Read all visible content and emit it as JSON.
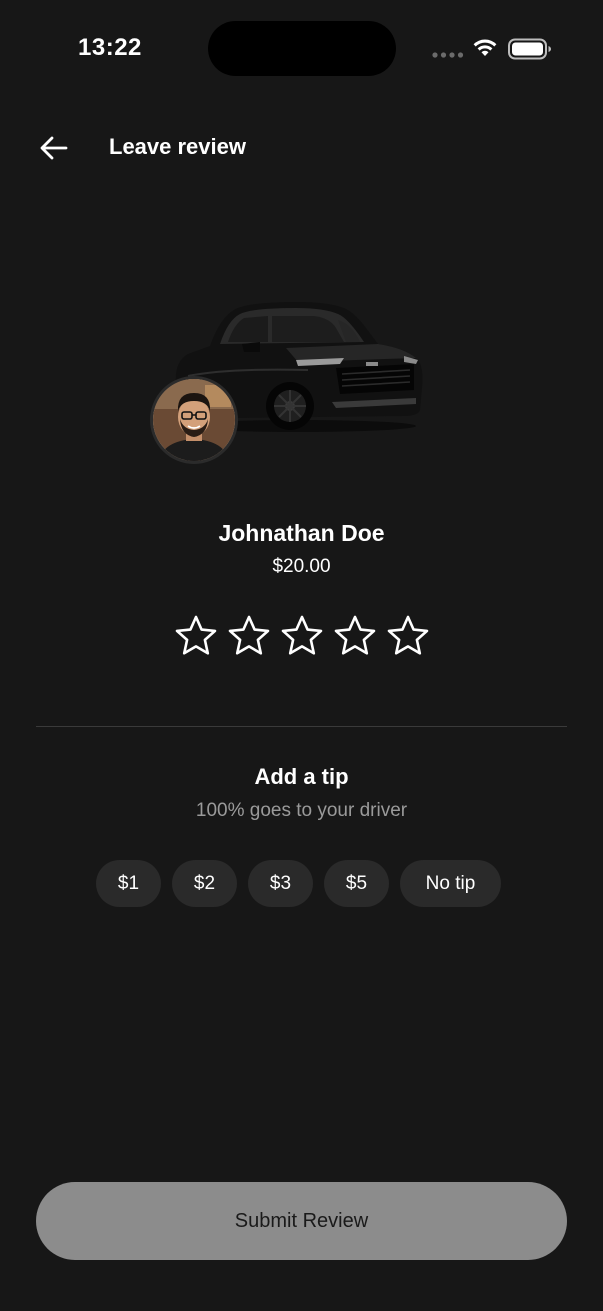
{
  "status_bar": {
    "time": "13:22"
  },
  "header": {
    "back_icon": "arrow-left-icon",
    "title": "Leave review"
  },
  "driver": {
    "name": "Johnathan Doe",
    "fare": "$20.00",
    "vehicle_image": "black-suv",
    "avatar_image": "driver-portrait"
  },
  "rating": {
    "max_stars": 5,
    "selected": 0,
    "star_icon": "star-outline-icon"
  },
  "tip": {
    "title": "Add a tip",
    "subtitle": "100% goes to your driver",
    "options": [
      "$1",
      "$2",
      "$3",
      "$5",
      "No tip"
    ]
  },
  "submit": {
    "label": "Submit Review"
  },
  "colors": {
    "background": "#171717",
    "chip": "#2a2a2a",
    "submit_disabled": "#8c8c8c",
    "muted_text": "#9a9a9a"
  }
}
